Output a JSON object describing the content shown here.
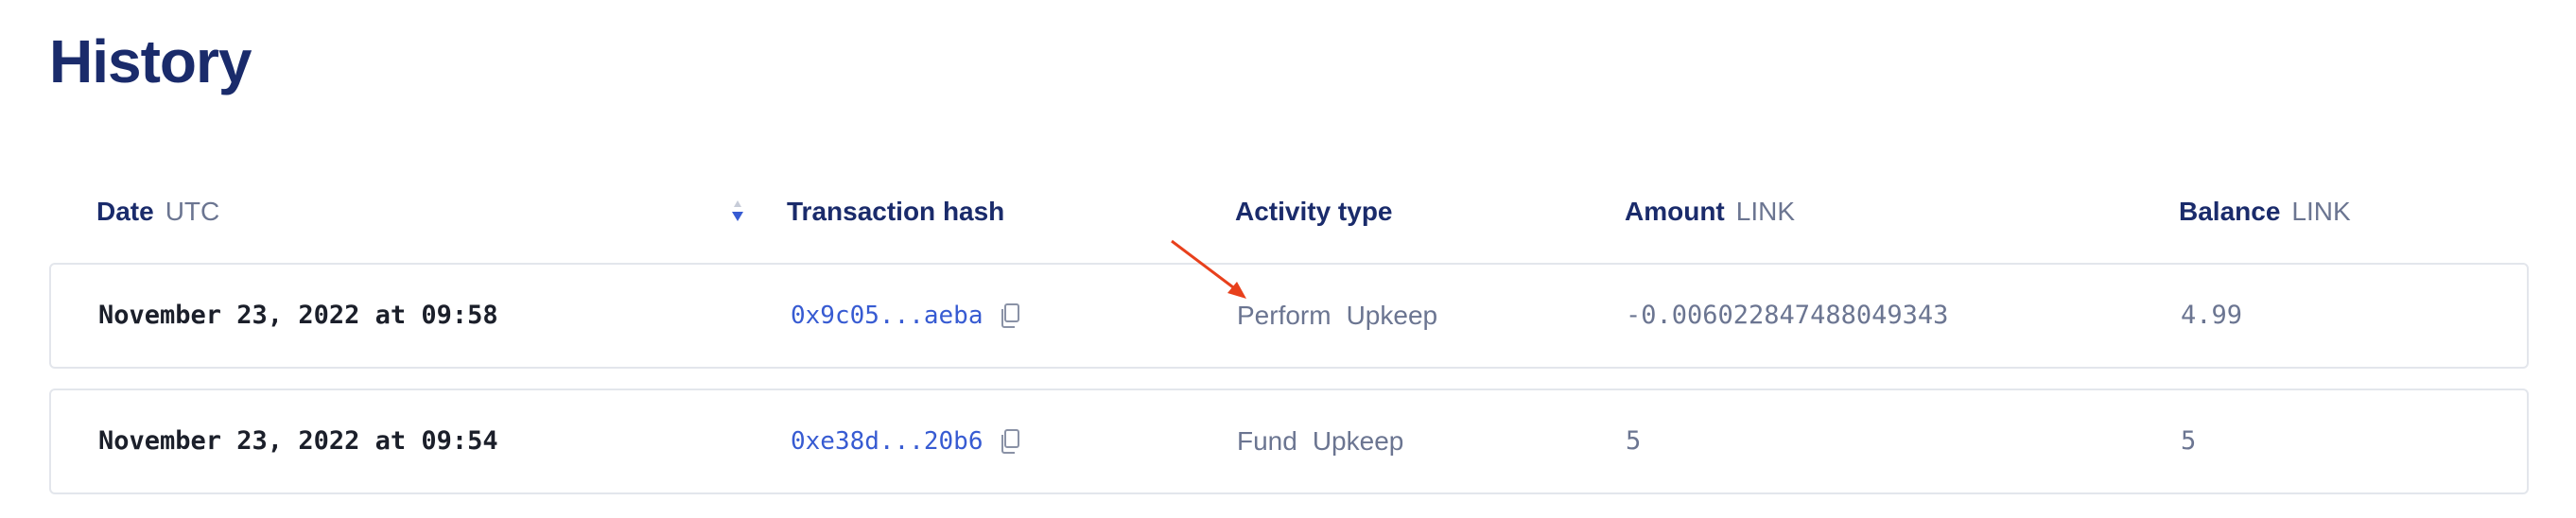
{
  "page": {
    "title": "History"
  },
  "table": {
    "columns": [
      {
        "label": "Date",
        "unit": "UTC"
      },
      {
        "label": "Transaction hash",
        "unit": ""
      },
      {
        "label": "Activity type",
        "unit": ""
      },
      {
        "label": "Amount",
        "unit": "LINK"
      },
      {
        "label": "Balance",
        "unit": "LINK"
      }
    ],
    "sort": {
      "column": "Date",
      "direction": "descending",
      "icon": "sort-desc-icon"
    },
    "rows": [
      {
        "date": "November 23, 2022 at 09:58",
        "hash": "0x9c05...aeba",
        "activity_word1": "Perform",
        "activity_word2": "Upkeep",
        "amount": "-0.006022847488049343",
        "balance": "4.99"
      },
      {
        "date": "November 23, 2022 at 09:54",
        "hash": "0xe38d...20b6",
        "activity_word1": "Fund",
        "activity_word2": "Upkeep",
        "amount": "5",
        "balance": "5"
      }
    ]
  },
  "colors": {
    "heading": "#1a2b6b",
    "link": "#375bd2",
    "muted": "#6b7591",
    "border": "#e3e6ec",
    "annotation_arrow": "#e8401c"
  },
  "icons": {
    "copy": "copy-icon",
    "annotation": "arrow-annotation"
  }
}
